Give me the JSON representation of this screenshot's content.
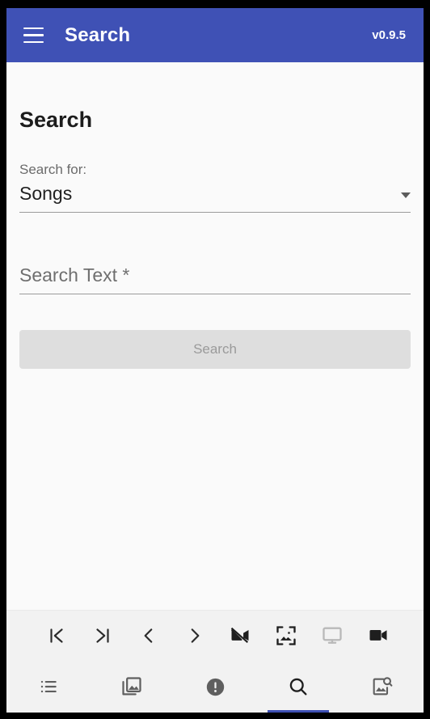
{
  "appbar": {
    "menu_icon": "hamburger-menu-icon",
    "title": "Search",
    "version": "v0.9.5",
    "background_color": "#3F51B5",
    "text_color": "#FFFFFF"
  },
  "main": {
    "page_title": "Search",
    "search_for": {
      "label": "Search for:",
      "selected_value": "Songs",
      "caret_icon": "chevron-down-icon"
    },
    "search_text": {
      "placeholder": "Search Text *",
      "value": ""
    },
    "search_button": {
      "label": "Search",
      "enabled": false,
      "background_color": "#DEDEDE",
      "text_color": "#9A9A9A"
    },
    "background_color": "#FAFAFA"
  },
  "toolbar": {
    "background_color": "#F2F2F2",
    "buttons": [
      {
        "name": "skip-to-first-icon",
        "label": "Skip to first",
        "state": "enabled"
      },
      {
        "name": "skip-to-last-icon",
        "label": "Skip to last",
        "state": "enabled"
      },
      {
        "name": "previous-icon",
        "label": "Previous",
        "state": "enabled"
      },
      {
        "name": "next-icon",
        "label": "Next",
        "state": "enabled"
      },
      {
        "name": "videocam-off-icon",
        "label": "Stop video",
        "state": "enabled"
      },
      {
        "name": "image-scan-icon",
        "label": "Scan image",
        "state": "enabled"
      },
      {
        "name": "monitor-icon",
        "label": "Monitor",
        "state": "disabled"
      },
      {
        "name": "videocam-icon",
        "label": "Video",
        "state": "enabled"
      }
    ]
  },
  "navbar": {
    "background_color": "#F2F2F2",
    "active_color": "#3F51B5",
    "items": [
      {
        "name": "nav-list-icon",
        "label": "List",
        "active": false
      },
      {
        "name": "nav-photo-library-icon",
        "label": "Library",
        "active": false
      },
      {
        "name": "nav-alert-icon",
        "label": "Alerts",
        "active": false
      },
      {
        "name": "nav-search-icon",
        "label": "Search",
        "active": true
      },
      {
        "name": "nav-image-search-icon",
        "label": "Image search",
        "active": false
      }
    ]
  }
}
